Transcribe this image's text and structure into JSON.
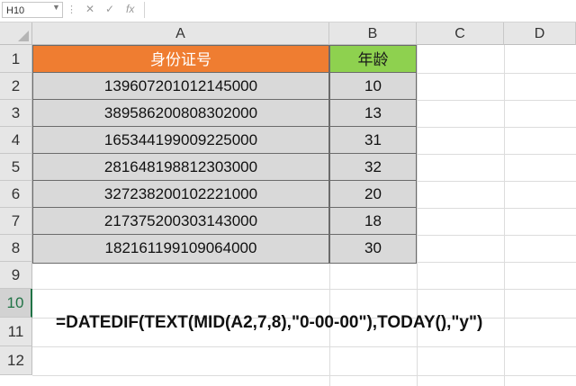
{
  "formula_bar": {
    "name_box": "H10",
    "cancel_icon": "✕",
    "enter_icon": "✓",
    "fx_label": "fx",
    "formula": ""
  },
  "columns": [
    "A",
    "B",
    "C",
    "D"
  ],
  "rows": [
    "1",
    "2",
    "3",
    "4",
    "5",
    "6",
    "7",
    "8",
    "9",
    "10",
    "11",
    "12"
  ],
  "table": {
    "headers": [
      "身份证号",
      "年龄"
    ],
    "rows": [
      {
        "id": "139607201012145000",
        "age": "10"
      },
      {
        "id": "389586200808302000",
        "age": "13"
      },
      {
        "id": "165344199009225000",
        "age": "31"
      },
      {
        "id": "281648198812303000",
        "age": "32"
      },
      {
        "id": "327238200102221000",
        "age": "20"
      },
      {
        "id": "217375200303143000",
        "age": "18"
      },
      {
        "id": "182161199109064000",
        "age": "30"
      }
    ]
  },
  "formula_note": "=DATEDIF(TEXT(MID(A2,7,8),\"0-00-00\"),TODAY(),\"y\")",
  "colors": {
    "header_a": "#ef7d31",
    "header_b": "#8ed14f",
    "data_fill": "#d9d9d9"
  }
}
